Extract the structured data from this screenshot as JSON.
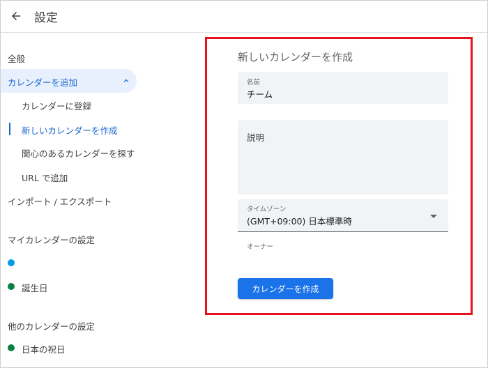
{
  "header": {
    "title": "設定"
  },
  "sidebar": {
    "general": "全般",
    "add_calendar": "カレンダーを追加",
    "add_calendar_items": [
      "カレンダーに登録",
      "新しいカレンダーを作成",
      "関心のあるカレンダーを探す",
      "URL で追加"
    ],
    "import_export": "インポート / エクスポート",
    "my_calendars_heading": "マイカレンダーの設定",
    "my_calendars": [
      {
        "label": "",
        "color": "#039be5"
      },
      {
        "label": "誕生日",
        "color": "#0b8043"
      }
    ],
    "other_calendars_heading": "他のカレンダーの設定",
    "other_calendars": [
      {
        "label": "日本の祝日",
        "color": "#0b8043"
      }
    ]
  },
  "form": {
    "title": "新しいカレンダーを作成",
    "name_label": "名前",
    "name_value": "チーム",
    "description_label": "説明",
    "timezone_label": "タイムゾーン",
    "timezone_value": "(GMT+09:00) 日本標準時",
    "owner_label": "オーナー",
    "create_button": "カレンダーを作成"
  },
  "colors": {
    "accent": "#1a73e8",
    "highlight": "#e8f0fe",
    "annotation": "#e5141b"
  }
}
